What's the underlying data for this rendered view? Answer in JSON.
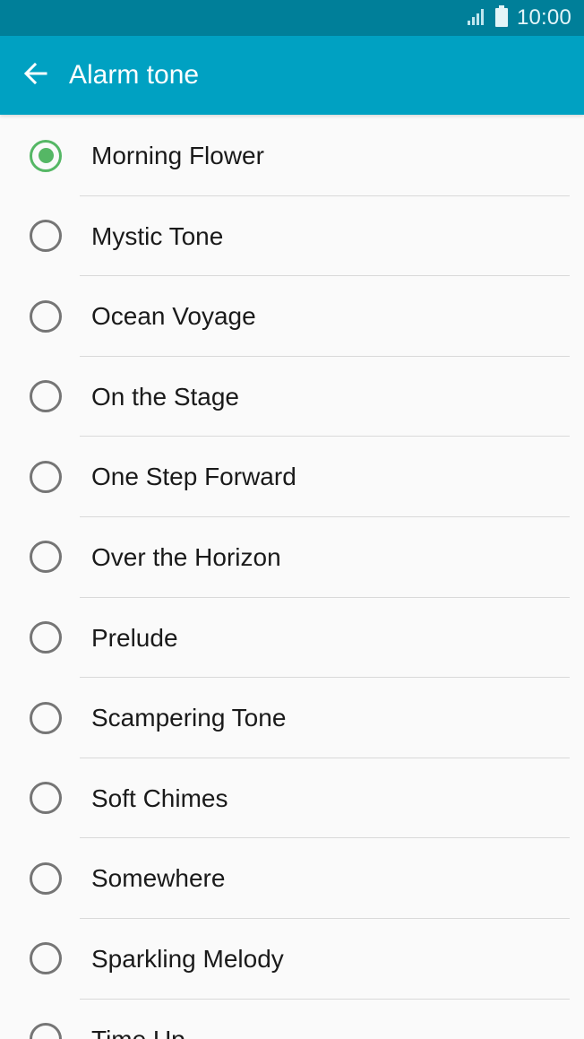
{
  "status_bar": {
    "time": "10:00",
    "icons": [
      "signal-icon",
      "battery-icon"
    ]
  },
  "app_bar": {
    "back_icon": "arrow-left-icon",
    "title": "Alarm tone"
  },
  "colors": {
    "status_bar": "#007f99",
    "app_bar": "#00a1c2",
    "radio_checked": "#55b765",
    "radio_unchecked": "#757575"
  },
  "tones": {
    "selected_index": 0,
    "items": [
      {
        "label": "Morning Flower"
      },
      {
        "label": "Mystic Tone"
      },
      {
        "label": "Ocean Voyage"
      },
      {
        "label": "On the Stage"
      },
      {
        "label": "One Step Forward"
      },
      {
        "label": "Over the Horizon"
      },
      {
        "label": "Prelude"
      },
      {
        "label": "Scampering Tone"
      },
      {
        "label": "Soft Chimes"
      },
      {
        "label": "Somewhere"
      },
      {
        "label": "Sparkling Melody"
      },
      {
        "label": "Time Up"
      }
    ]
  }
}
